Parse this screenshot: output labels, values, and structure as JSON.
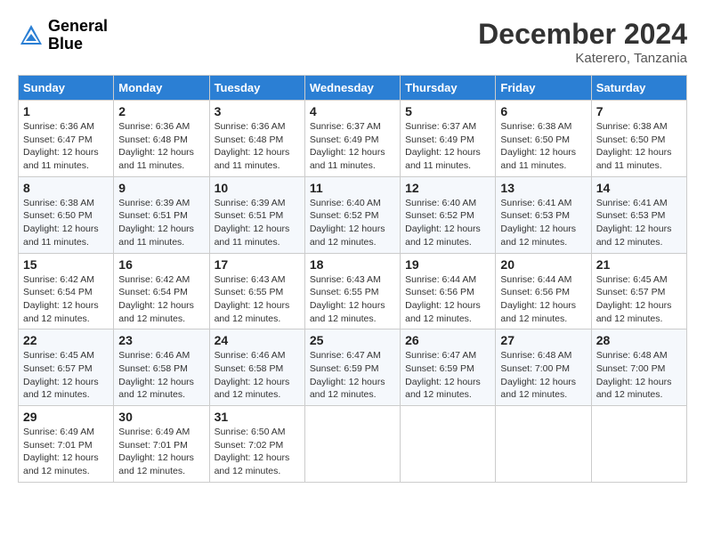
{
  "logo": {
    "line1": "General",
    "line2": "Blue"
  },
  "title": "December 2024",
  "subtitle": "Katerero, Tanzania",
  "days_header": [
    "Sunday",
    "Monday",
    "Tuesday",
    "Wednesday",
    "Thursday",
    "Friday",
    "Saturday"
  ],
  "weeks": [
    [
      {
        "day": "1",
        "info": "Sunrise: 6:36 AM\nSunset: 6:47 PM\nDaylight: 12 hours\nand 11 minutes."
      },
      {
        "day": "2",
        "info": "Sunrise: 6:36 AM\nSunset: 6:48 PM\nDaylight: 12 hours\nand 11 minutes."
      },
      {
        "day": "3",
        "info": "Sunrise: 6:36 AM\nSunset: 6:48 PM\nDaylight: 12 hours\nand 11 minutes."
      },
      {
        "day": "4",
        "info": "Sunrise: 6:37 AM\nSunset: 6:49 PM\nDaylight: 12 hours\nand 11 minutes."
      },
      {
        "day": "5",
        "info": "Sunrise: 6:37 AM\nSunset: 6:49 PM\nDaylight: 12 hours\nand 11 minutes."
      },
      {
        "day": "6",
        "info": "Sunrise: 6:38 AM\nSunset: 6:50 PM\nDaylight: 12 hours\nand 11 minutes."
      },
      {
        "day": "7",
        "info": "Sunrise: 6:38 AM\nSunset: 6:50 PM\nDaylight: 12 hours\nand 11 minutes."
      }
    ],
    [
      {
        "day": "8",
        "info": "Sunrise: 6:38 AM\nSunset: 6:50 PM\nDaylight: 12 hours\nand 11 minutes."
      },
      {
        "day": "9",
        "info": "Sunrise: 6:39 AM\nSunset: 6:51 PM\nDaylight: 12 hours\nand 11 minutes."
      },
      {
        "day": "10",
        "info": "Sunrise: 6:39 AM\nSunset: 6:51 PM\nDaylight: 12 hours\nand 11 minutes."
      },
      {
        "day": "11",
        "info": "Sunrise: 6:40 AM\nSunset: 6:52 PM\nDaylight: 12 hours\nand 12 minutes."
      },
      {
        "day": "12",
        "info": "Sunrise: 6:40 AM\nSunset: 6:52 PM\nDaylight: 12 hours\nand 12 minutes."
      },
      {
        "day": "13",
        "info": "Sunrise: 6:41 AM\nSunset: 6:53 PM\nDaylight: 12 hours\nand 12 minutes."
      },
      {
        "day": "14",
        "info": "Sunrise: 6:41 AM\nSunset: 6:53 PM\nDaylight: 12 hours\nand 12 minutes."
      }
    ],
    [
      {
        "day": "15",
        "info": "Sunrise: 6:42 AM\nSunset: 6:54 PM\nDaylight: 12 hours\nand 12 minutes."
      },
      {
        "day": "16",
        "info": "Sunrise: 6:42 AM\nSunset: 6:54 PM\nDaylight: 12 hours\nand 12 minutes."
      },
      {
        "day": "17",
        "info": "Sunrise: 6:43 AM\nSunset: 6:55 PM\nDaylight: 12 hours\nand 12 minutes."
      },
      {
        "day": "18",
        "info": "Sunrise: 6:43 AM\nSunset: 6:55 PM\nDaylight: 12 hours\nand 12 minutes."
      },
      {
        "day": "19",
        "info": "Sunrise: 6:44 AM\nSunset: 6:56 PM\nDaylight: 12 hours\nand 12 minutes."
      },
      {
        "day": "20",
        "info": "Sunrise: 6:44 AM\nSunset: 6:56 PM\nDaylight: 12 hours\nand 12 minutes."
      },
      {
        "day": "21",
        "info": "Sunrise: 6:45 AM\nSunset: 6:57 PM\nDaylight: 12 hours\nand 12 minutes."
      }
    ],
    [
      {
        "day": "22",
        "info": "Sunrise: 6:45 AM\nSunset: 6:57 PM\nDaylight: 12 hours\nand 12 minutes."
      },
      {
        "day": "23",
        "info": "Sunrise: 6:46 AM\nSunset: 6:58 PM\nDaylight: 12 hours\nand 12 minutes."
      },
      {
        "day": "24",
        "info": "Sunrise: 6:46 AM\nSunset: 6:58 PM\nDaylight: 12 hours\nand 12 minutes."
      },
      {
        "day": "25",
        "info": "Sunrise: 6:47 AM\nSunset: 6:59 PM\nDaylight: 12 hours\nand 12 minutes."
      },
      {
        "day": "26",
        "info": "Sunrise: 6:47 AM\nSunset: 6:59 PM\nDaylight: 12 hours\nand 12 minutes."
      },
      {
        "day": "27",
        "info": "Sunrise: 6:48 AM\nSunset: 7:00 PM\nDaylight: 12 hours\nand 12 minutes."
      },
      {
        "day": "28",
        "info": "Sunrise: 6:48 AM\nSunset: 7:00 PM\nDaylight: 12 hours\nand 12 minutes."
      }
    ],
    [
      {
        "day": "29",
        "info": "Sunrise: 6:49 AM\nSunset: 7:01 PM\nDaylight: 12 hours\nand 12 minutes."
      },
      {
        "day": "30",
        "info": "Sunrise: 6:49 AM\nSunset: 7:01 PM\nDaylight: 12 hours\nand 12 minutes."
      },
      {
        "day": "31",
        "info": "Sunrise: 6:50 AM\nSunset: 7:02 PM\nDaylight: 12 hours\nand 12 minutes."
      },
      null,
      null,
      null,
      null
    ]
  ]
}
